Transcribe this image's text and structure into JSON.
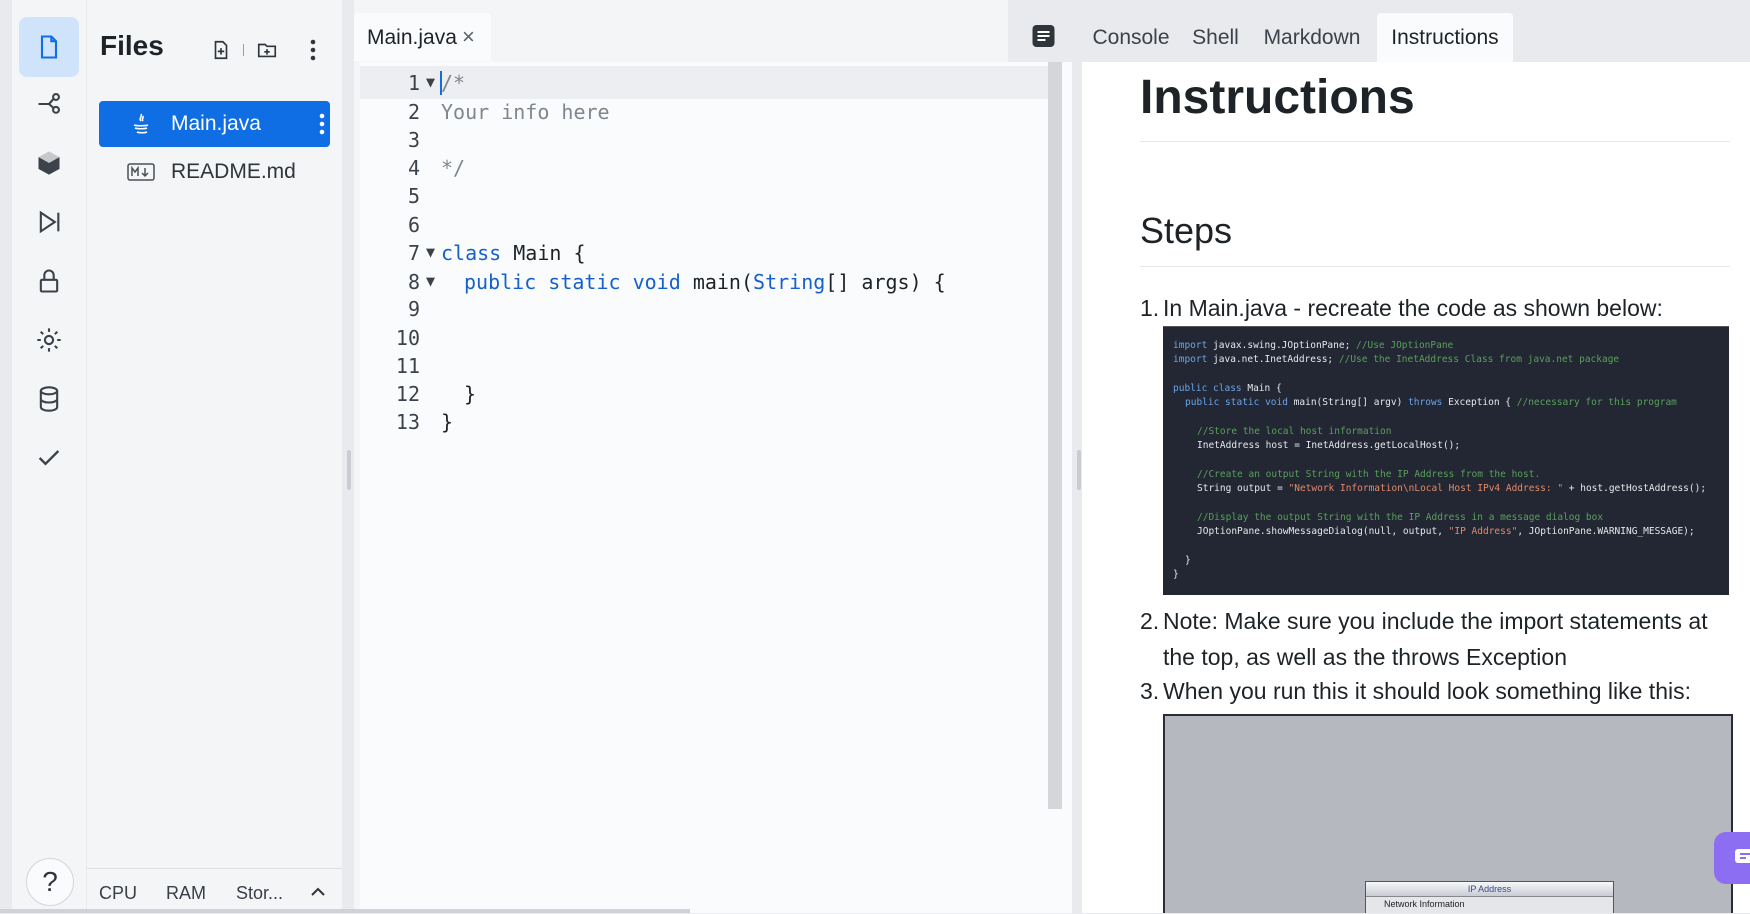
{
  "files_panel": {
    "title": "Files",
    "files": [
      {
        "name": "Main.java",
        "icon": "java-icon",
        "selected": true
      },
      {
        "name": "README.md",
        "icon": "markdown-icon",
        "selected": false
      }
    ],
    "resources": {
      "cpu": "CPU",
      "ram": "RAM",
      "storage": "Stor..."
    }
  },
  "editor": {
    "tab_label": "Main.java",
    "close_glyph": "×",
    "lines": [
      {
        "n": "1",
        "text": "/*"
      },
      {
        "n": "2",
        "text": "Your info here"
      },
      {
        "n": "3",
        "text": ""
      },
      {
        "n": "4",
        "text": "*/"
      },
      {
        "n": "5",
        "text": ""
      },
      {
        "n": "6",
        "text": ""
      },
      {
        "n": "7",
        "kw1": "class",
        "rest": " Main {"
      },
      {
        "n": "8",
        "kw1": "public",
        "kw2": "static",
        "kw3": "void",
        "mid": "main(",
        "kw4": "String",
        "rest": "[] args) {"
      },
      {
        "n": "9",
        "text": ""
      },
      {
        "n": "10",
        "text": ""
      },
      {
        "n": "11",
        "text": ""
      },
      {
        "n": "12",
        "text": "}"
      },
      {
        "n": "13",
        "text": "}"
      }
    ]
  },
  "right_tabs": [
    "Console",
    "Shell",
    "Markdown",
    "Instructions"
  ],
  "active_tab": "Instructions",
  "instructions": {
    "title": "Instructions",
    "steps_heading": "Steps",
    "steps": [
      {
        "num": "1.",
        "text": "In Main.java - recreate the code as shown below:"
      },
      {
        "num": "2.",
        "text": "Note: Make sure you include the import statements at the top, as well as the throws Exception"
      },
      {
        "num": "3.",
        "text": "When you run this it should look something like this:"
      }
    ],
    "code_image": {
      "l1a": "import",
      "l1b": " javax.swing.JOptionPane; ",
      "l1c": "//Use JOptionPane",
      "l2a": "import",
      "l2b": " java.net.InetAddress; ",
      "l2c": "//Use the InetAddress Class from java.net package",
      "l4a": "public class",
      "l4b": " Main {",
      "l5a": "public static void",
      "l5b": " main(String[] argv) ",
      "l5c": "throws",
      "l5d": " Exception { ",
      "l5e": "//necessary for this program",
      "l7": "//Store the local host information",
      "l8": "InetAddress host = InetAddress.getLocalHost();",
      "l10": "//Create an output String with the IP Address from the host.",
      "l11a": "String output = ",
      "l11b": "\"Network Information\\nLocal Host IPv4 Address: \"",
      "l11c": " + host.getHostAddress();",
      "l13": "//Display the output String with the IP Address in a message dialog box",
      "l14a": "JOptionPane.showMessageDialog(null, output, ",
      "l14b": "\"IP Address\"",
      "l14c": ", JOptionPane.WARNING_MESSAGE);",
      "l16": "}",
      "l17": "}"
    },
    "output_image": {
      "dialog_title": "IP Address",
      "dialog_text": "Network Information"
    }
  },
  "help_glyph": "?",
  "colors": {
    "accent": "#0f6ee3",
    "keyword": "#1660cc",
    "chat": "#8c6ef2"
  }
}
